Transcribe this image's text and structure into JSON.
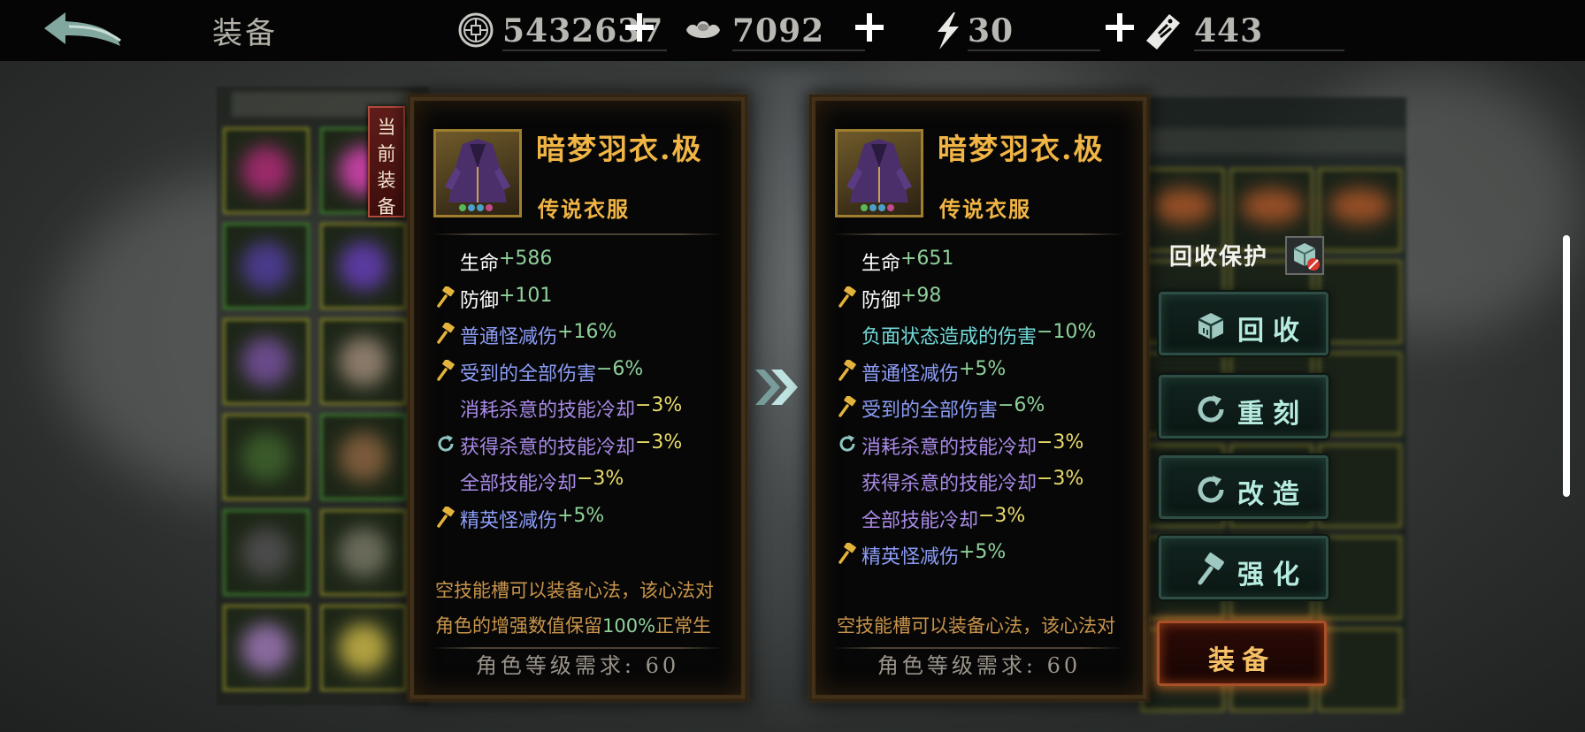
{
  "header": {
    "title": "装备",
    "coins": "5432637",
    "ingots": "7092",
    "energy": "30",
    "tickets": "443"
  },
  "current_tag": [
    "当",
    "前",
    "装",
    "备"
  ],
  "left_card": {
    "name": "暗梦羽衣.极",
    "rarity": "传说衣服",
    "stats": [
      {
        "icon": "none",
        "name": "生命",
        "value": "+586",
        "name_color": "white",
        "value_color": "green"
      },
      {
        "icon": "hammer",
        "name": "防御",
        "value": "+101",
        "name_color": "white",
        "value_color": "green"
      },
      {
        "icon": "hammer",
        "name": "普通怪减伤",
        "value": "+16%",
        "name_color": "blue",
        "value_color": "green"
      },
      {
        "icon": "hammer",
        "name": "受到的全部伤害",
        "value": "−6%",
        "name_color": "blue",
        "value_color": "green"
      },
      {
        "icon": "none",
        "name": "消耗杀意的技能冷却",
        "value": "−3%",
        "name_color": "purple",
        "value_color": "yellow"
      },
      {
        "icon": "refresh",
        "name": "获得杀意的技能冷却",
        "value": "−3%",
        "name_color": "purple",
        "value_color": "yellow"
      },
      {
        "icon": "none",
        "name": "全部技能冷却",
        "value": "−3%",
        "name_color": "purple",
        "value_color": "yellow"
      },
      {
        "icon": "hammer",
        "name": "精英怪减伤",
        "value": "+5%",
        "name_color": "blue",
        "value_color": "green"
      }
    ],
    "desc_line1": "空技能槽可以装备心法，该心法对",
    "desc_line2_a": "角色的增强数值保留",
    "desc_line2_b": "100%",
    "desc_line2_c": "正常生",
    "requirement": "角色等级需求: 60"
  },
  "right_card": {
    "name": "暗梦羽衣.极",
    "rarity": "传说衣服",
    "stats": [
      {
        "icon": "none",
        "name": "生命",
        "value": "+651",
        "name_color": "white",
        "value_color": "green"
      },
      {
        "icon": "hammer",
        "name": "防御",
        "value": "+98",
        "name_color": "white",
        "value_color": "green"
      },
      {
        "icon": "none",
        "name": "负面状态造成的伤害",
        "value": "−10%",
        "name_color": "cyan",
        "value_color": "green"
      },
      {
        "icon": "hammer",
        "name": "普通怪减伤",
        "value": "+5%",
        "name_color": "blue",
        "value_color": "green"
      },
      {
        "icon": "hammer",
        "name": "受到的全部伤害",
        "value": "−6%",
        "name_color": "blue",
        "value_color": "green"
      },
      {
        "icon": "refresh",
        "name": "消耗杀意的技能冷却",
        "value": "−3%",
        "name_color": "purple",
        "value_color": "yellow"
      },
      {
        "icon": "none",
        "name": "获得杀意的技能冷却",
        "value": "−3%",
        "name_color": "purple",
        "value_color": "yellow"
      },
      {
        "icon": "none",
        "name": "全部技能冷却",
        "value": "−3%",
        "name_color": "purple",
        "value_color": "yellow"
      },
      {
        "icon": "hammer",
        "name": "精英怪减伤",
        "value": "+5%",
        "name_color": "blue",
        "value_color": "green"
      }
    ],
    "desc_line1": "空技能槽可以装备心法，该心法对",
    "requirement": "角色等级需求: 60"
  },
  "actions": {
    "recycle_protect": "回收保护",
    "recycle": "回收",
    "reforge": "重刻",
    "modify": "改造",
    "enhance": "强化",
    "equip": "装备"
  }
}
